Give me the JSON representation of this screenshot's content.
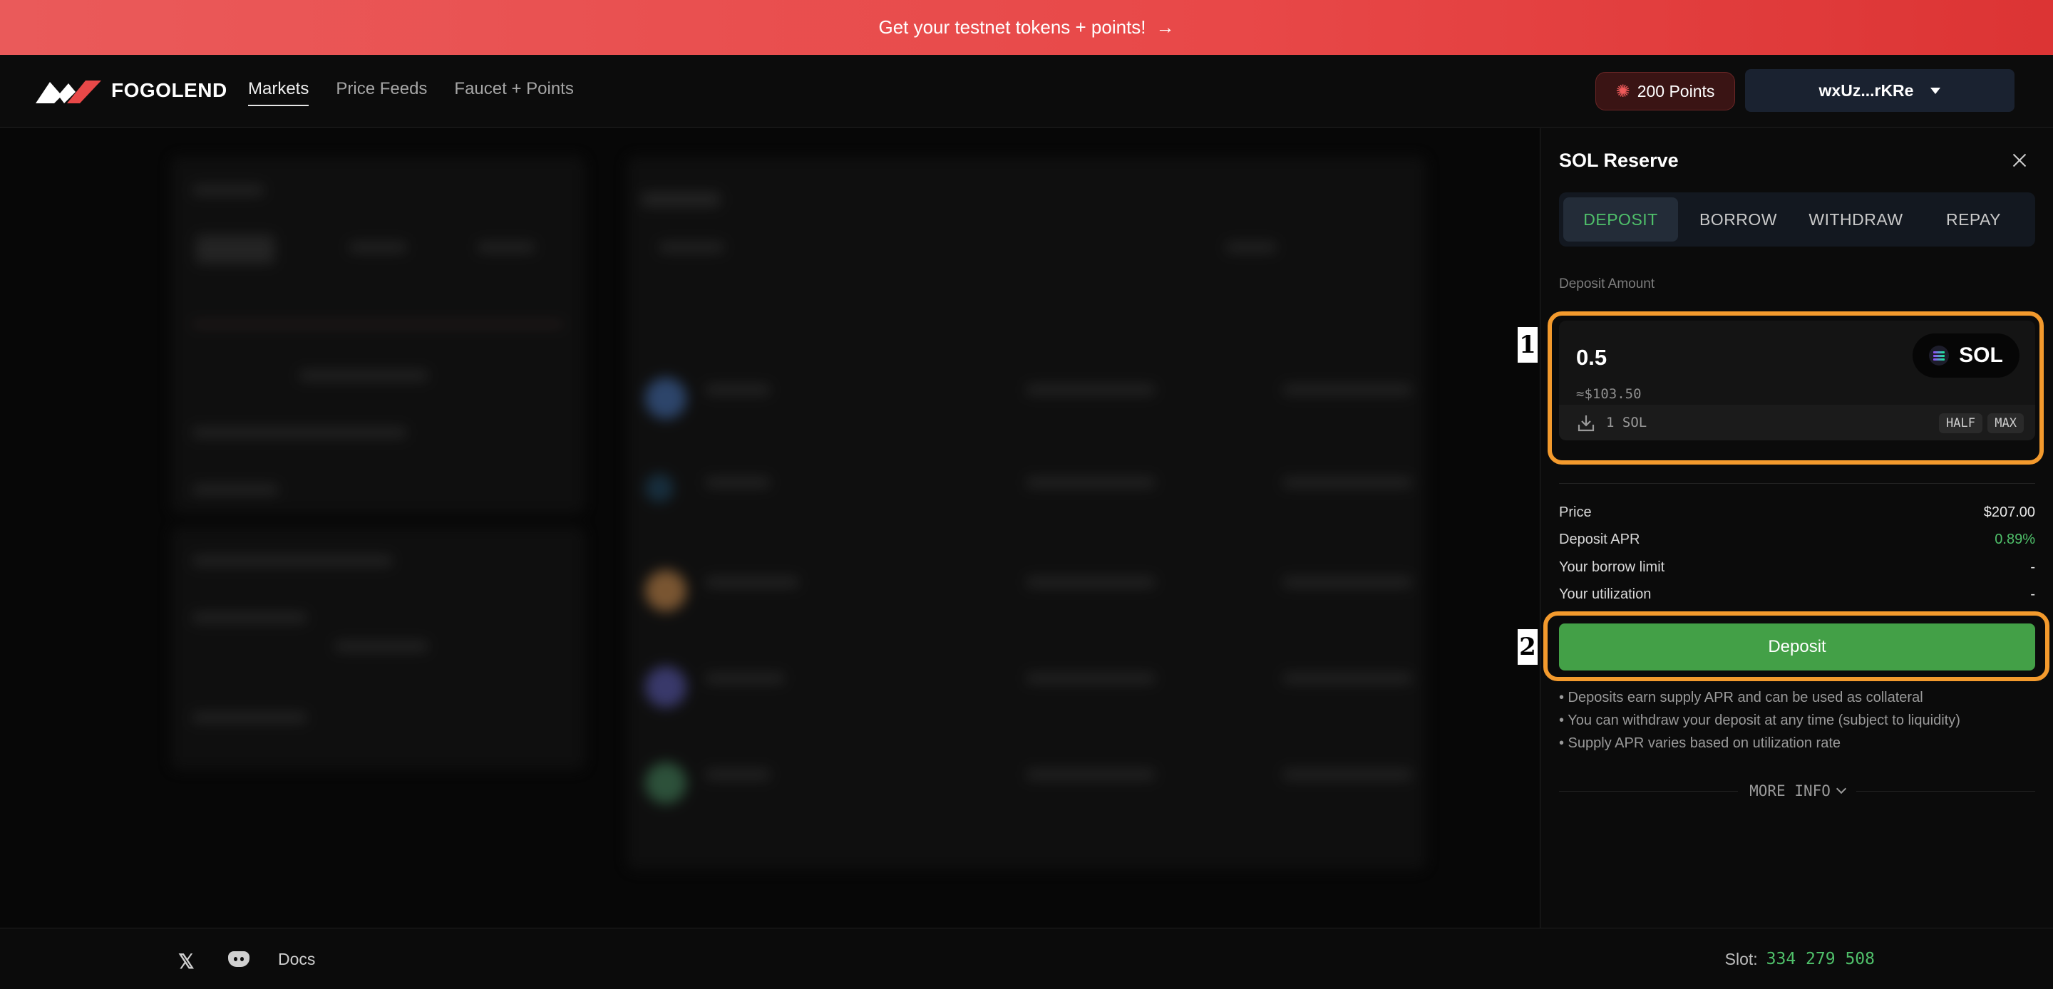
{
  "banner": {
    "text": "Get your testnet tokens + points!",
    "arrow": "→"
  },
  "header": {
    "brand": "FOGOLEND",
    "nav": [
      "Markets",
      "Price Feeds",
      "Faucet + Points"
    ],
    "active_nav": "Markets",
    "points_label": "200 Points",
    "wallet_label": "wxUz...rKRe"
  },
  "panel": {
    "title": "SOL Reserve",
    "tabs": [
      "DEPOSIT",
      "BORROW",
      "WITHDRAW",
      "REPAY"
    ],
    "active_tab": "DEPOSIT",
    "amount_label": "Deposit Amount",
    "amount_value": "0.5",
    "amount_usd": "≈$103.50",
    "token": "SOL",
    "balance": "1 SOL",
    "half_label": "HALF",
    "max_label": "MAX",
    "stats": [
      {
        "label": "Price",
        "value": "$207.00"
      },
      {
        "label": "Deposit APR",
        "value": "0.89%"
      },
      {
        "label": "Your borrow limit",
        "value": "-"
      },
      {
        "label": "Your utilization",
        "value": "-"
      }
    ],
    "deposit_button": "Deposit",
    "notes": [
      "• Deposits earn supply APR and can be used as collateral",
      "• You can withdraw your deposit at any time (subject to liquidity)",
      "• Supply APR varies based on utilization rate"
    ],
    "more_info": "MORE INFO"
  },
  "annotations": [
    "1",
    "2"
  ],
  "footer": {
    "docs": "Docs",
    "slot_label": "Slot:",
    "slot_value": "334 279 508"
  },
  "colors": {
    "accent_green": "#43a047",
    "banner_red": "#e84848",
    "annotation_orange": "#f39a2d"
  }
}
